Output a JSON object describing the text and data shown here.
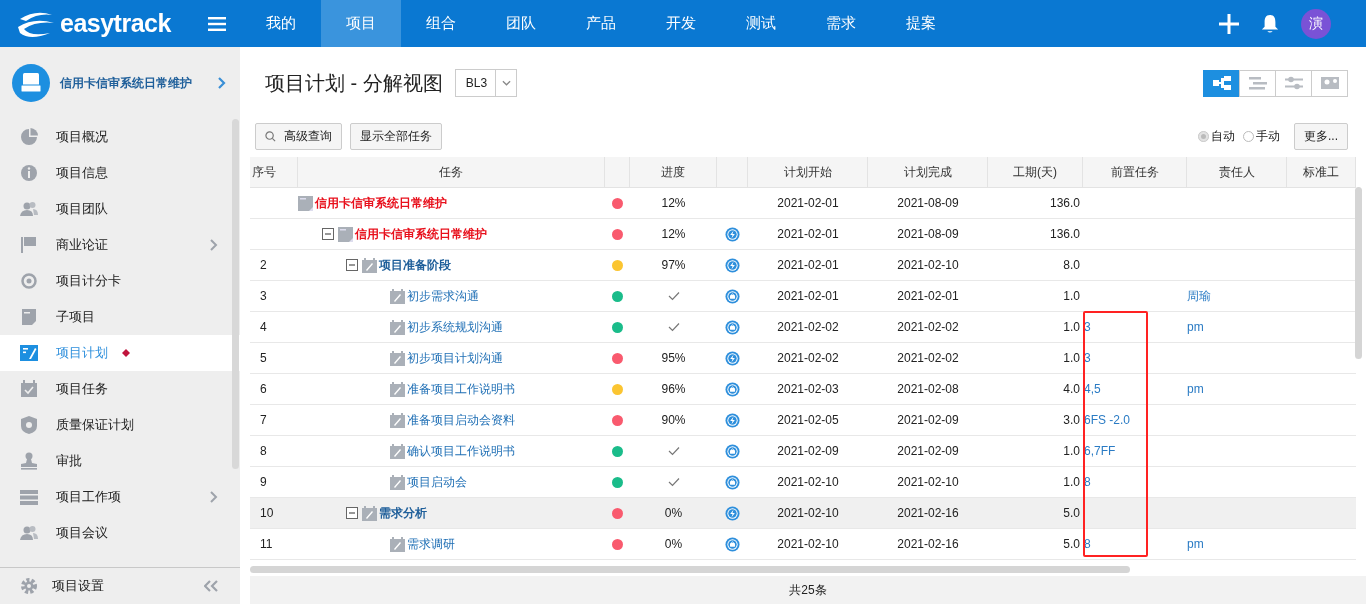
{
  "brand": "easytrack",
  "nav": [
    {
      "label": "我的",
      "selected": false
    },
    {
      "label": "项目",
      "selected": true
    },
    {
      "label": "组合",
      "selected": false
    },
    {
      "label": "团队",
      "selected": false
    },
    {
      "label": "产品",
      "selected": false
    },
    {
      "label": "开发",
      "selected": false
    },
    {
      "label": "测试",
      "selected": false
    },
    {
      "label": "需求",
      "selected": false
    },
    {
      "label": "提案",
      "selected": false
    }
  ],
  "avatar": "演",
  "project": {
    "name": "信用卡信审系统日常维护"
  },
  "sidebar": {
    "items": [
      {
        "label": "项目概况",
        "selected": false,
        "expandable": false
      },
      {
        "label": "项目信息",
        "selected": false,
        "expandable": false
      },
      {
        "label": "项目团队",
        "selected": false,
        "expandable": false
      },
      {
        "label": "商业论证",
        "selected": false,
        "expandable": true
      },
      {
        "label": "项目计分卡",
        "selected": false,
        "expandable": false
      },
      {
        "label": "子项目",
        "selected": false,
        "expandable": false
      },
      {
        "label": "项目计划",
        "selected": true,
        "expandable": false
      },
      {
        "label": "项目任务",
        "selected": false,
        "expandable": false
      },
      {
        "label": "质量保证计划",
        "selected": false,
        "expandable": false
      },
      {
        "label": "审批",
        "selected": false,
        "expandable": false
      },
      {
        "label": "项目工作项",
        "selected": false,
        "expandable": true
      },
      {
        "label": "项目会议",
        "selected": false,
        "expandable": false
      }
    ],
    "settings": "项目设置"
  },
  "title": "项目计划 - 分解视图",
  "baseline": "BL3",
  "view_buttons": [
    {
      "selected": true
    },
    {
      "selected": false
    },
    {
      "selected": false
    },
    {
      "selected": false
    }
  ],
  "toolbar": {
    "search": "高级查询",
    "show_all": "显示全部任务",
    "modes": [
      {
        "label": "自动",
        "selected": true
      },
      {
        "label": "手动",
        "selected": false
      }
    ],
    "more": "更多..."
  },
  "table": {
    "columns": [
      "序号",
      "任务",
      "进度",
      "计划开始",
      "计划完成",
      "工期(天)",
      "前置任务",
      "责任人",
      "标准工"
    ],
    "rows": [
      {
        "name": "信用卡信审系统日常维护",
        "kind": "root",
        "color": "#f95a6e",
        "progress": "12%",
        "done": false,
        "selected": false,
        "start": "2021-02-01",
        "end": "2021-08-09",
        "duration": "136.0",
        "children": [
          {
            "name": "信用卡信审系统日常维护",
            "kind": "project",
            "expanded": true,
            "color": "#f95a6e",
            "progress": "12%",
            "done": false,
            "auto": true,
            "selected": false,
            "start": "2021-02-01",
            "end": "2021-08-09",
            "duration": "136.0",
            "children": [
              {
                "num": "2",
                "name": "项目准备阶段",
                "kind": "phase",
                "expanded": true,
                "color": "#fbc531",
                "progress": "97%",
                "done": false,
                "auto": true,
                "selected": false,
                "start": "2021-02-01",
                "end": "2021-02-10",
                "duration": "8.0",
                "children": [
                  {
                    "num": "3",
                    "name": "初步需求沟通",
                    "kind": "task",
                    "color": "#1abc8a",
                    "done": true,
                    "auto": false,
                    "selected": false,
                    "start": "2021-02-01",
                    "end": "2021-02-01",
                    "duration": "1.0",
                    "owner": "周瑜"
                  },
                  {
                    "num": "4",
                    "name": "初步系统规划沟通",
                    "kind": "task",
                    "color": "#1abc8a",
                    "done": true,
                    "auto": false,
                    "selected": false,
                    "start": "2021-02-02",
                    "end": "2021-02-02",
                    "duration": "1.0",
                    "pred": "3",
                    "owner": "pm"
                  },
                  {
                    "num": "5",
                    "name": "初步项目计划沟通",
                    "kind": "task",
                    "color": "#f95a6e",
                    "progress": "95%",
                    "done": false,
                    "auto": true,
                    "selected": false,
                    "start": "2021-02-02",
                    "end": "2021-02-02",
                    "duration": "1.0",
                    "pred": "3"
                  },
                  {
                    "num": "6",
                    "name": "准备项目工作说明书",
                    "kind": "task",
                    "color": "#fbc531",
                    "progress": "96%",
                    "done": false,
                    "auto": false,
                    "selected": false,
                    "start": "2021-02-03",
                    "end": "2021-02-08",
                    "duration": "4.0",
                    "pred": "4,5",
                    "owner": "pm"
                  },
                  {
                    "num": "7",
                    "name": "准备项目启动会资料",
                    "kind": "task",
                    "color": "#f95a6e",
                    "progress": "90%",
                    "done": false,
                    "auto": true,
                    "selected": false,
                    "start": "2021-02-05",
                    "end": "2021-02-09",
                    "duration": "3.0",
                    "pred": "6FS -2.0"
                  },
                  {
                    "num": "8",
                    "name": "确认项目工作说明书",
                    "kind": "task",
                    "color": "#1abc8a",
                    "done": true,
                    "auto": false,
                    "selected": false,
                    "start": "2021-02-09",
                    "end": "2021-02-09",
                    "duration": "1.0",
                    "pred": "6,7FF"
                  },
                  {
                    "num": "9",
                    "name": "项目启动会",
                    "kind": "task",
                    "color": "#1abc8a",
                    "done": true,
                    "auto": false,
                    "selected": false,
                    "start": "2021-02-10",
                    "end": "2021-02-10",
                    "duration": "1.0",
                    "pred": "8"
                  }
                ]
              },
              {
                "num": "10",
                "name": "需求分析",
                "kind": "phase",
                "expanded": true,
                "color": "#f95a6e",
                "progress": "0%",
                "done": false,
                "auto": true,
                "selected": true,
                "start": "2021-02-10",
                "end": "2021-02-16",
                "duration": "5.0",
                "children": [
                  {
                    "num": "11",
                    "name": "需求调研",
                    "kind": "task",
                    "color": "#f95a6e",
                    "progress": "0%",
                    "done": false,
                    "auto": false,
                    "selected": false,
                    "start": "2021-02-10",
                    "end": "2021-02-16",
                    "duration": "5.0",
                    "pred": "8",
                    "owner": "pm"
                  }
                ]
              }
            ]
          }
        ]
      }
    ]
  },
  "footer": "共25条"
}
